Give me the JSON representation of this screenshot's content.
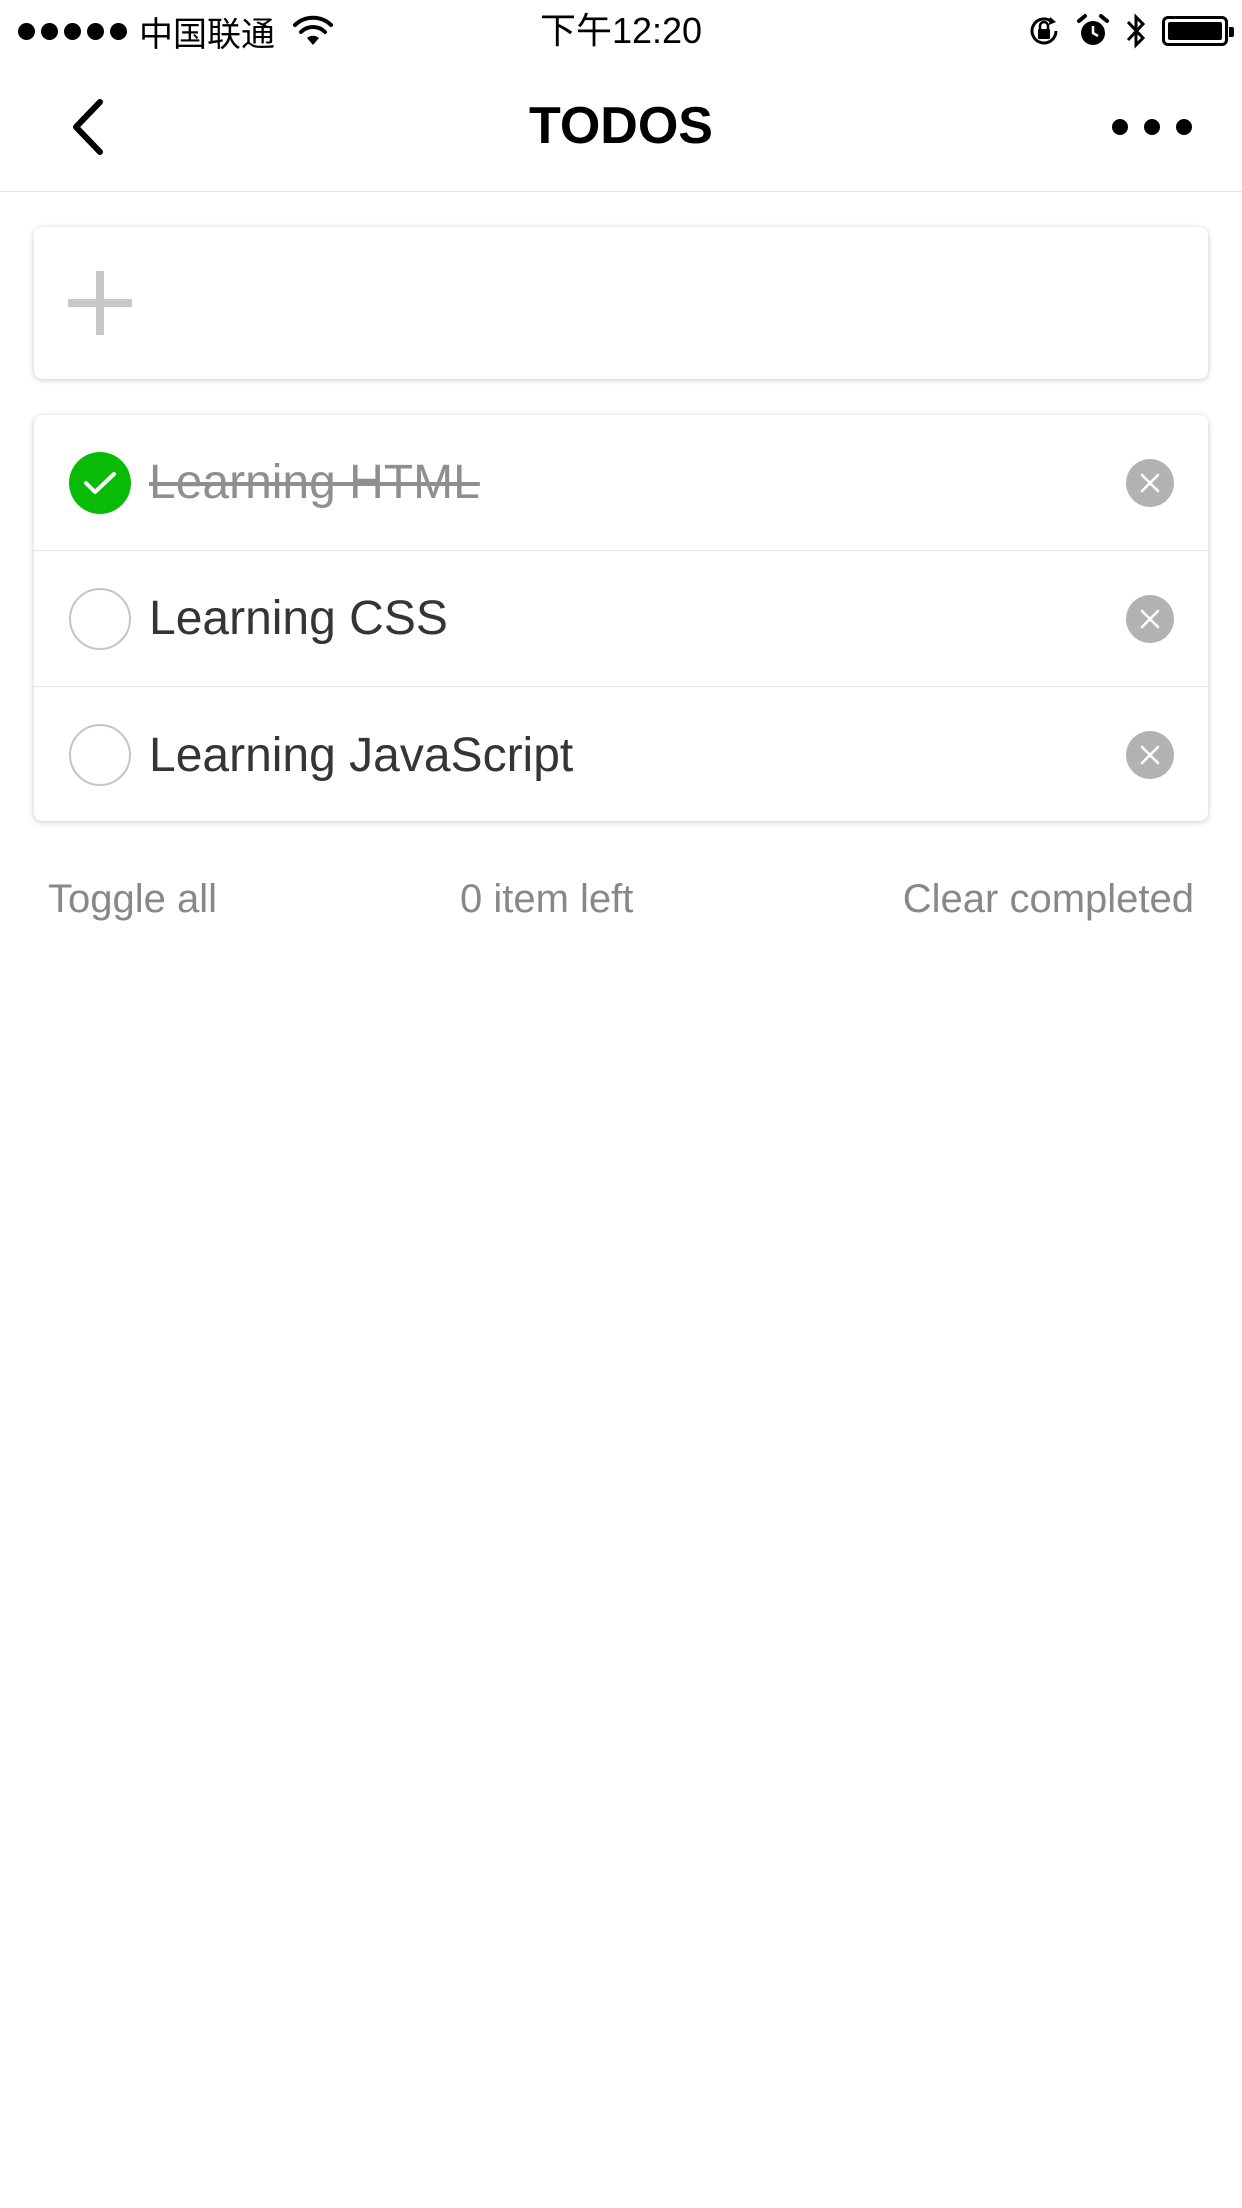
{
  "status_bar": {
    "carrier": "中国联通",
    "time": "下午12:20",
    "icons": [
      "signal-dots-icon",
      "wifi-icon",
      "orientation-lock-icon",
      "alarm-icon",
      "bluetooth-icon",
      "battery-icon"
    ]
  },
  "nav": {
    "title": "TODOS",
    "back_icon": "chevron-left-icon",
    "more_icon": "more-dots-icon"
  },
  "add": {
    "icon": "plus-icon",
    "placeholder": ""
  },
  "todos": [
    {
      "text": "Learning HTML",
      "completed": true
    },
    {
      "text": "Learning CSS",
      "completed": false
    },
    {
      "text": "Learning JavaScript",
      "completed": false
    }
  ],
  "footer": {
    "toggle_all": "Toggle all",
    "items_left": "0 item left",
    "clear_completed": "Clear completed"
  },
  "colors": {
    "check_done": "#09bb07",
    "remove_bg": "#b2b2b2",
    "footer_text": "#888888"
  }
}
